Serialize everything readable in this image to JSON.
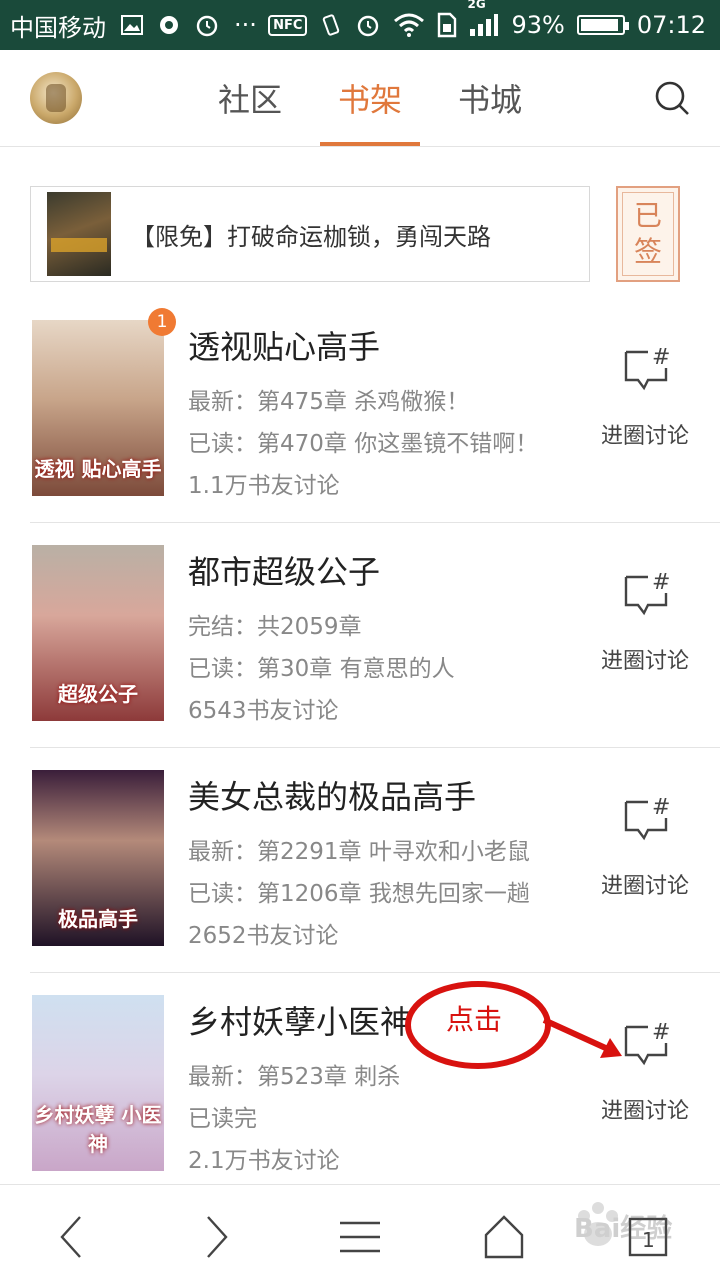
{
  "status_bar": {
    "carrier": "中国移动",
    "network": "2G",
    "battery": "93%",
    "battery_level": 0.93,
    "nfc": "NFC",
    "time": "07:12"
  },
  "header": {
    "tabs": [
      {
        "label": "社区",
        "active": false
      },
      {
        "label": "书架",
        "active": true
      },
      {
        "label": "书城",
        "active": false
      }
    ]
  },
  "banner": {
    "text": "【限免】打破命运枷锁，勇闯天路",
    "signed_label_1": "已",
    "signed_label_2": "签"
  },
  "books": [
    {
      "title": "透视贴心高手",
      "line1": "最新：第475章 杀鸡儆猴！",
      "line2": "已读：第470章 你这墨镜不错啊！",
      "line3": "1.1万书友讨论",
      "badge": "1",
      "cover_text": "透视 贴心高手",
      "action": "进圈讨论"
    },
    {
      "title": "都市超级公子",
      "line1": "完结：共2059章",
      "line2": "已读：第30章 有意思的人",
      "line3": "6543书友讨论",
      "cover_text": "超级公子",
      "action": "进圈讨论"
    },
    {
      "title": "美女总裁的极品高手",
      "line1": "最新：第2291章 叶寻欢和小老鼠",
      "line2": "已读：第1206章 我想先回家一趟",
      "line3": "2652书友讨论",
      "cover_text": "极品高手",
      "action": "进圈讨论"
    },
    {
      "title": "乡村妖孽小医神",
      "line1": "最新：第523章 刺杀",
      "line2": "已读完",
      "line3": "2.1万书友讨论",
      "cover_text": "乡村妖孽 小医神",
      "action": "进圈讨论"
    }
  ],
  "annotation": {
    "text": "点击",
    "color": "#d8120f"
  },
  "watermark": "Bai经验",
  "accent_color": "#e0783c"
}
